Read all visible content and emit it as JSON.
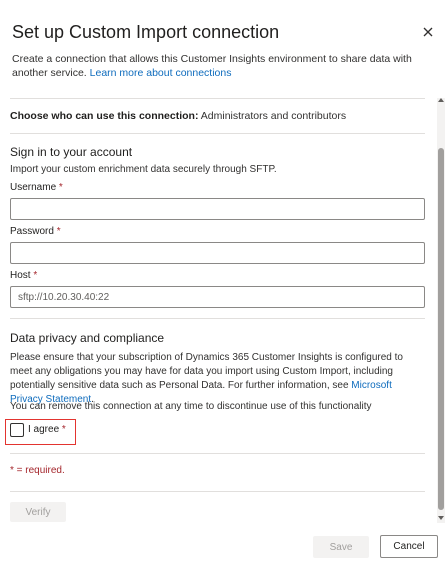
{
  "header": {
    "title": "Set up Custom Import connection",
    "close_icon": "close-icon"
  },
  "description": {
    "text": "Create a connection that allows this Customer Insights environment to share data with another service.",
    "link": "Learn more about connections"
  },
  "permissions": {
    "label": "Choose who can use this connection:",
    "value": "Administrators and contributors"
  },
  "signin": {
    "heading": "Sign in to your account",
    "subtitle": "Import your custom enrichment data securely through SFTP.",
    "username_label": "Username",
    "password_label": "Password",
    "host_label": "Host",
    "required_marker": "*",
    "username_value": "",
    "password_value": "",
    "host_placeholder": "sftp://10.20.30.40:22"
  },
  "privacy": {
    "heading": "Data privacy and compliance",
    "text": "Please ensure that your subscription of Dynamics 365 Customer Insights is configured to meet any obligations you may have for data you import using Custom Import, including potentially sensitive data such as Personal Data. For further information, see",
    "link": "Microsoft Privacy Statement",
    "link_suffix": ".",
    "remove_text": "You can remove this connection at any time to discontinue use of this functionality",
    "agree_label": "I agree",
    "agree_checked": false
  },
  "required_note": "* = required.",
  "buttons": {
    "verify": "Verify",
    "save": "Save",
    "cancel": "Cancel"
  },
  "colors": {
    "link": "#0f6cbd",
    "required": "#a4262c",
    "highlight_border": "#e3342f"
  }
}
